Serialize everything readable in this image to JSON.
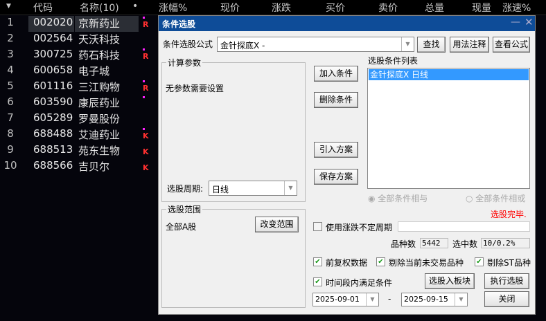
{
  "table": {
    "headers": [
      "代码",
      "名称(10)",
      "•",
      "涨幅%",
      "现价",
      "涨跌",
      "买价",
      "卖价",
      "总量",
      "现量",
      "涨速%"
    ],
    "rows": [
      {
        "num": "1",
        "code": "002020",
        "name": "京新药业",
        "flag": "R",
        "dot": true
      },
      {
        "num": "2",
        "code": "002564",
        "name": "天沃科技",
        "flag": "",
        "dot": false
      },
      {
        "num": "3",
        "code": "300725",
        "name": "药石科技",
        "flag": "R",
        "dot": true
      },
      {
        "num": "4",
        "code": "600658",
        "name": "电子城",
        "flag": "",
        "dot": false
      },
      {
        "num": "5",
        "code": "601116",
        "name": "三江购物",
        "flag": "R",
        "dot": true
      },
      {
        "num": "6",
        "code": "603590",
        "name": "康辰药业",
        "flag": "",
        "dot": true
      },
      {
        "num": "7",
        "code": "605289",
        "name": "罗曼股份",
        "flag": "",
        "dot": false
      },
      {
        "num": "8",
        "code": "688488",
        "name": "艾迪药业",
        "flag": "K",
        "dot": true
      },
      {
        "num": "9",
        "code": "688513",
        "name": "苑东生物",
        "flag": "K",
        "dot": false
      },
      {
        "num": "10",
        "code": "688566",
        "name": "吉贝尔",
        "flag": "K",
        "dot": false
      }
    ]
  },
  "dialog": {
    "title": "条件选股",
    "formula_label": "条件选股公式",
    "formula_value": "金针探底X  -",
    "find": "查找",
    "usage": "用法注释",
    "view_formula": "查看公式",
    "params_group": "计算参数",
    "params_text": "无参数需要设置",
    "period_label": "选股周期:",
    "period_value": "日线",
    "add": "加入条件",
    "delete": "删除条件",
    "import": "引入方案",
    "save": "保存方案",
    "list_label": "选股条件列表",
    "list_items": [
      "金针探底X  日线"
    ],
    "radio_and": "全部条件相与",
    "radio_or": "全部条件相或",
    "status": "选股完毕.",
    "range_group": "选股范围",
    "range_value": "全部A股",
    "change_range": "改变范围",
    "use_period": "使用涨跌不定周期",
    "count_label": "品种数",
    "count_value": "5442",
    "selected_label": "选中数",
    "selected_value": "10/0.2%",
    "fq": "前复权数据",
    "exclude_untraded": "剔除当前未交易品种",
    "exclude_st": "剔除ST品种",
    "time_range": "时间段内满足条件",
    "to_block": "选股入板块",
    "execute": "执行选股",
    "date_from": "2025-09-01",
    "dash": "-",
    "date_to": "2025-09-15",
    "close": "关闭",
    "status_color": "#ff0000"
  }
}
